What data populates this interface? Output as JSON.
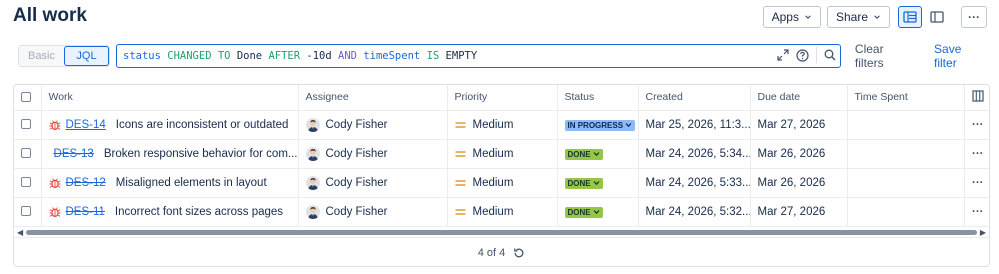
{
  "page": {
    "title": "All work"
  },
  "toolbar": {
    "apps_label": "Apps",
    "share_label": "Share",
    "more_label": "···"
  },
  "search": {
    "modes": [
      {
        "label": "Basic",
        "active": false
      },
      {
        "label": "JQL",
        "active": true
      }
    ],
    "query": {
      "t1": "status",
      "t2": "CHANGED",
      "t3": "TO",
      "t4": "Done",
      "t5": "AFTER",
      "t6": "-10d",
      "t7": "AND",
      "t8": "timeSpent",
      "t9": "IS",
      "t10": "EMPTY"
    },
    "clear_filters_label": "Clear filters",
    "save_filter_label": "Save filter"
  },
  "table": {
    "columns": {
      "work": "Work",
      "assignee": "Assignee",
      "priority": "Priority",
      "status": "Status",
      "created": "Created",
      "due": "Due date",
      "time_spent": "Time Spent"
    },
    "rows": [
      {
        "key": "DES-14",
        "summary": "Icons are inconsistent or outdated",
        "assignee": "Cody Fisher",
        "priority": "Medium",
        "status": "IN PROGRESS",
        "created": "Mar 25, 2026, 11:3...",
        "due": "Mar 27, 2026",
        "time_spent": ""
      },
      {
        "key": "DES-13",
        "summary": "Broken responsive behavior for com...",
        "assignee": "Cody Fisher",
        "priority": "Medium",
        "status": "DONE",
        "created": "Mar 24, 2026, 5:34...",
        "due": "Mar 26, 2026",
        "time_spent": ""
      },
      {
        "key": "DES-12",
        "summary": "Misaligned elements in layout",
        "assignee": "Cody Fisher",
        "priority": "Medium",
        "status": "DONE",
        "created": "Mar 24, 2026, 5:33...",
        "due": "Mar 26, 2026",
        "time_spent": ""
      },
      {
        "key": "DES-11",
        "summary": "Incorrect font sizes across pages",
        "assignee": "Cody Fisher",
        "priority": "Medium",
        "status": "DONE",
        "created": "Mar 24, 2026, 5:32...",
        "due": "Mar 27, 2026",
        "time_spent": ""
      }
    ],
    "row_more_label": "···"
  },
  "pagination": {
    "label": "4 of 4"
  },
  "colors": {
    "accent": "#1868db",
    "in_progress": "#8fb8f6",
    "done": "#94c748",
    "bug": "#e2483d",
    "priority_medium": "#e2a03f"
  }
}
